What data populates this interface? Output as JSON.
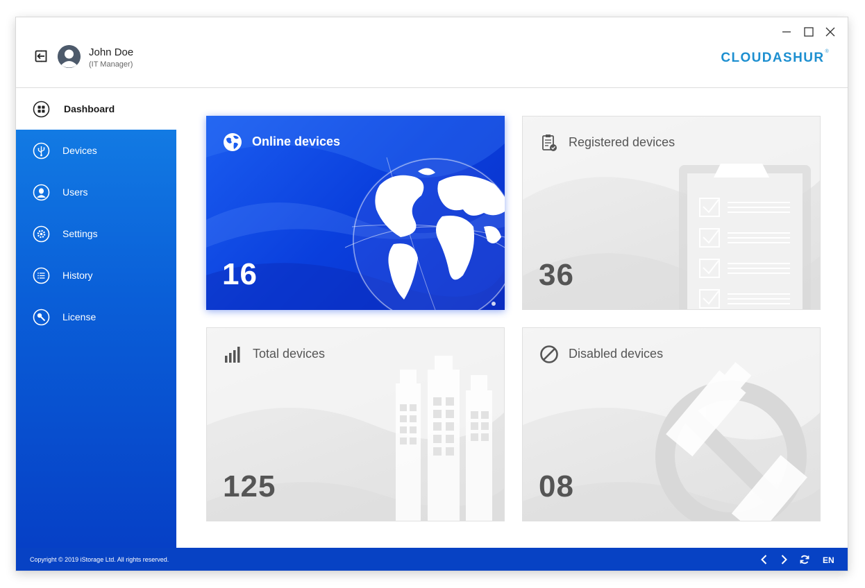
{
  "user": {
    "name": "John Doe",
    "role": "(IT Manager)"
  },
  "brand": {
    "name": "CLOUDASHUR",
    "mark": "®"
  },
  "sidebar": {
    "items": [
      {
        "label": "Dashboard",
        "icon": "dashboard-icon",
        "active": true
      },
      {
        "label": "Devices",
        "icon": "usb-icon"
      },
      {
        "label": "Users",
        "icon": "user-icon"
      },
      {
        "label": "Settings",
        "icon": "gear-icon"
      },
      {
        "label": "History",
        "icon": "list-icon"
      },
      {
        "label": "License",
        "icon": "key-icon"
      }
    ]
  },
  "cards": {
    "online": {
      "title": "Online devices",
      "value": "16",
      "icon": "globe-icon"
    },
    "registered": {
      "title": "Registered devices",
      "value": "36",
      "icon": "clipboard-icon"
    },
    "total": {
      "title": "Total devices",
      "value": "125",
      "icon": "bar-chart-icon"
    },
    "disabled": {
      "title": "Disabled devices",
      "value": "08",
      "icon": "disabled-icon"
    }
  },
  "footer": {
    "copyright": "Copyright © 2019 iStorage Ltd. All rights reserved.",
    "language": "EN"
  },
  "colors": {
    "accent": "#1d8fd0",
    "sidebar": "#0a5fd8",
    "footer": "#0742c4",
    "card_blue": "#1b5df0"
  }
}
